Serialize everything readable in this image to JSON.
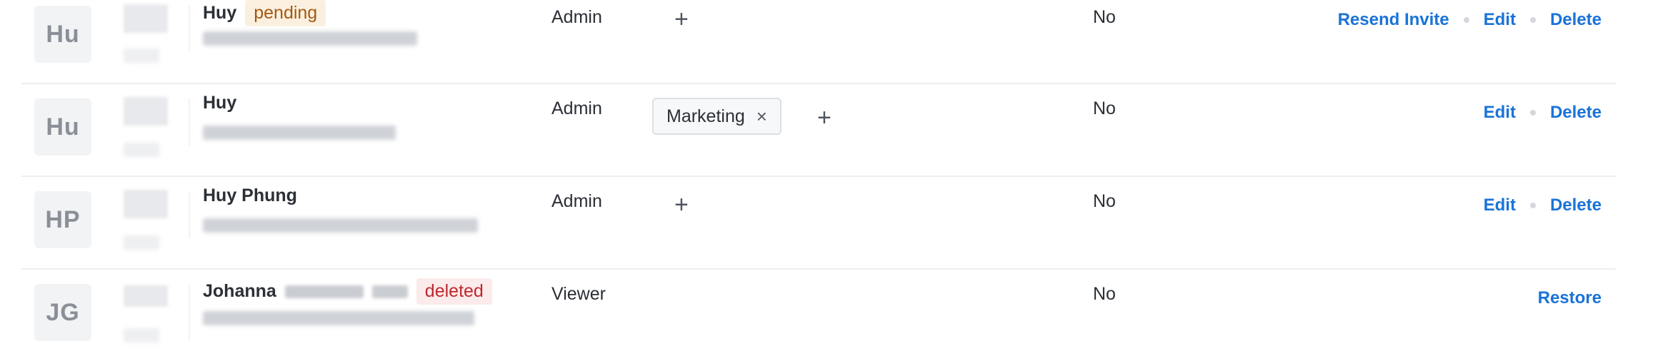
{
  "rows": [
    {
      "initials": "Hu",
      "name": "Huy",
      "badge": "pending",
      "role": "Admin",
      "tags": [],
      "add_tag": "+",
      "status": "No",
      "actions": [
        "Resend Invite",
        "Edit",
        "Delete"
      ]
    },
    {
      "initials": "Hu",
      "name": "Huy",
      "badge": "",
      "role": "Admin",
      "tags": [
        {
          "label": "Marketing",
          "remove": "×"
        }
      ],
      "add_tag": "+",
      "status": "No",
      "actions": [
        "Edit",
        "Delete"
      ]
    },
    {
      "initials": "HP",
      "name": "Huy Phung",
      "badge": "",
      "role": "Admin",
      "tags": [],
      "add_tag": "+",
      "status": "No",
      "actions": [
        "Edit",
        "Delete"
      ]
    },
    {
      "initials": "JG",
      "name": "Johanna",
      "badge": "deleted",
      "role": "Viewer",
      "tags": [],
      "add_tag": "",
      "status": "No",
      "actions": [
        "Restore"
      ]
    }
  ],
  "colors": {
    "link": "#1a73d8",
    "pending_bg": "#fbf0e0",
    "pending_text": "#a35a12",
    "deleted_bg": "#fcebeb",
    "deleted_text": "#c0282d",
    "avatar_bg": "#f2f3f5"
  },
  "icons": {
    "add_tag": "plus-icon",
    "remove_tag": "close-icon"
  }
}
